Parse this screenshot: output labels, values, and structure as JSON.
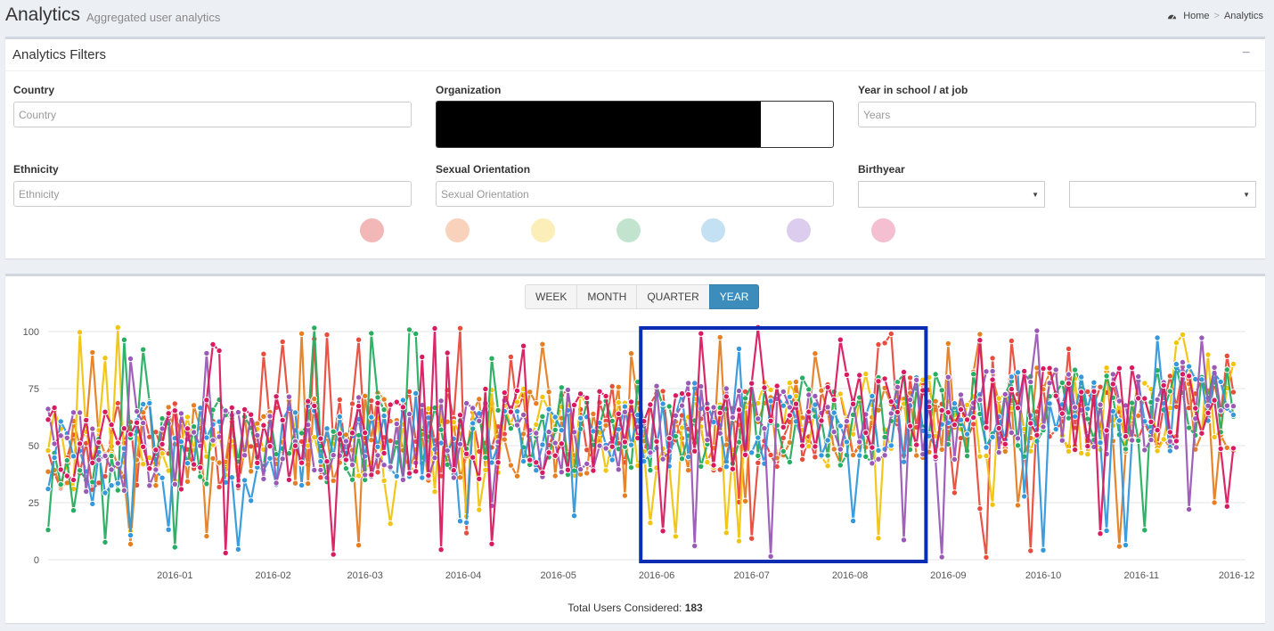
{
  "header": {
    "title": "Analytics",
    "subtitle": "Aggregated user analytics",
    "breadcrumb": {
      "home": "Home",
      "current": "Analytics"
    }
  },
  "filters": {
    "title": "Analytics Filters",
    "country": {
      "label": "Country",
      "placeholder": "Country"
    },
    "organization": {
      "label": "Organization"
    },
    "year": {
      "label": "Year in school / at job",
      "placeholder": "Years"
    },
    "ethnicity": {
      "label": "Ethnicity",
      "placeholder": "Ethnicity"
    },
    "orientation": {
      "label": "Sexual Orientation",
      "placeholder": "Sexual Orientation"
    },
    "birthyear": {
      "label": "Birthyear"
    },
    "swatches": [
      "#f2b8b8",
      "#f8d2bb",
      "#fbeeb8",
      "#c2e4cf",
      "#c4e0f3",
      "#dccdee",
      "#f3bfd1"
    ]
  },
  "period": {
    "buttons": [
      "WEEK",
      "MONTH",
      "QUARTER",
      "YEAR"
    ],
    "active": "YEAR"
  },
  "chart_data": {
    "type": "line",
    "x_start": "2015-11-22",
    "x_end": "2016-12-01",
    "x_ticks": [
      "2016-01",
      "2016-02",
      "2016-03",
      "2016-04",
      "2016-05",
      "2016-06",
      "2016-07",
      "2016-08",
      "2016-09",
      "2016-10",
      "2016-11",
      "2016-12"
    ],
    "ylim": [
      0,
      100
    ],
    "y_ticks": [
      0,
      25,
      50,
      75,
      100
    ],
    "grid": true,
    "series": [
      {
        "color": "#e74c3c"
      },
      {
        "color": "#e67e22"
      },
      {
        "color": "#f1c40f"
      },
      {
        "color": "#27ae60"
      },
      {
        "color": "#3498db"
      },
      {
        "color": "#9b59b6"
      },
      {
        "color": "#d81b60"
      }
    ],
    "highlight": {
      "x_from": "2016-05-27",
      "x_to": "2016-08-25",
      "color": "#0a2db3"
    }
  },
  "footer": {
    "total_label": "Total Users Considered:",
    "total_value": "183"
  }
}
